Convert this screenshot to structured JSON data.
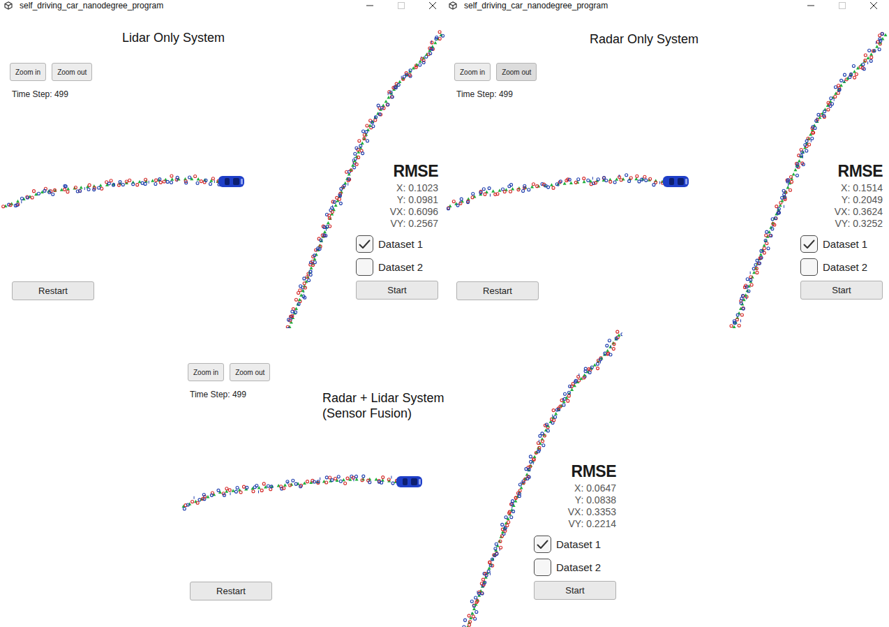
{
  "windows": [
    {
      "title": "self_driving_car_nanodegree_program",
      "window_buttons": [
        {
          "kind": "minimize",
          "disabled": false
        },
        {
          "kind": "maximize",
          "disabled": true
        },
        {
          "kind": "close",
          "disabled": false
        }
      ],
      "caption": [
        "Lidar Only System"
      ],
      "zoom_buttons": [
        {
          "label": "Zoom in",
          "highlighted": false
        },
        {
          "label": "Zoom out",
          "highlighted": false
        }
      ],
      "time_step": "Time Step: 499",
      "rmse": {
        "heading": "RMSE",
        "rows": [
          "X: 0.1023",
          "Y: 0.0981",
          "VX: 0.6096",
          "VY: 0.2567"
        ]
      },
      "datasets": [
        {
          "label": "Dataset 1",
          "checked": true
        },
        {
          "label": "Dataset 2",
          "checked": false
        }
      ],
      "start": "Start",
      "restart": "Restart"
    },
    {
      "title": "self_driving_car_nanodegree_program",
      "window_buttons": [
        {
          "kind": "minimize",
          "disabled": false
        },
        {
          "kind": "maximize",
          "disabled": true
        },
        {
          "kind": "close",
          "disabled": false
        }
      ],
      "caption": [
        "Radar Only System"
      ],
      "zoom_buttons": [
        {
          "label": "Zoom in",
          "highlighted": false
        },
        {
          "label": "Zoom out",
          "highlighted": true
        }
      ],
      "time_step": "Time Step: 499",
      "rmse": {
        "heading": "RMSE",
        "rows": [
          "X: 0.1514",
          "Y: 0.2049",
          "VX: 0.3624",
          "VY: 0.3252"
        ]
      },
      "datasets": [
        {
          "label": "Dataset 1",
          "checked": true
        },
        {
          "label": "Dataset 2",
          "checked": false
        }
      ],
      "start": "Start",
      "restart": "Restart"
    },
    {
      "caption": [
        "Radar + Lidar System",
        "(Sensor Fusion)"
      ],
      "zoom_buttons": [
        {
          "label": "Zoom in",
          "highlighted": false
        },
        {
          "label": "Zoom out",
          "highlighted": false
        }
      ],
      "time_step": "Time Step: 499",
      "rmse": {
        "heading": "RMSE",
        "rows": [
          "X: 0.0647",
          "Y: 0.0838",
          "VX: 0.3353",
          "VY: 0.2214"
        ]
      },
      "datasets": [
        {
          "label": "Dataset 1",
          "checked": true
        },
        {
          "label": "Dataset 2",
          "checked": false
        }
      ],
      "start": "Start",
      "restart": "Restart"
    }
  ]
}
